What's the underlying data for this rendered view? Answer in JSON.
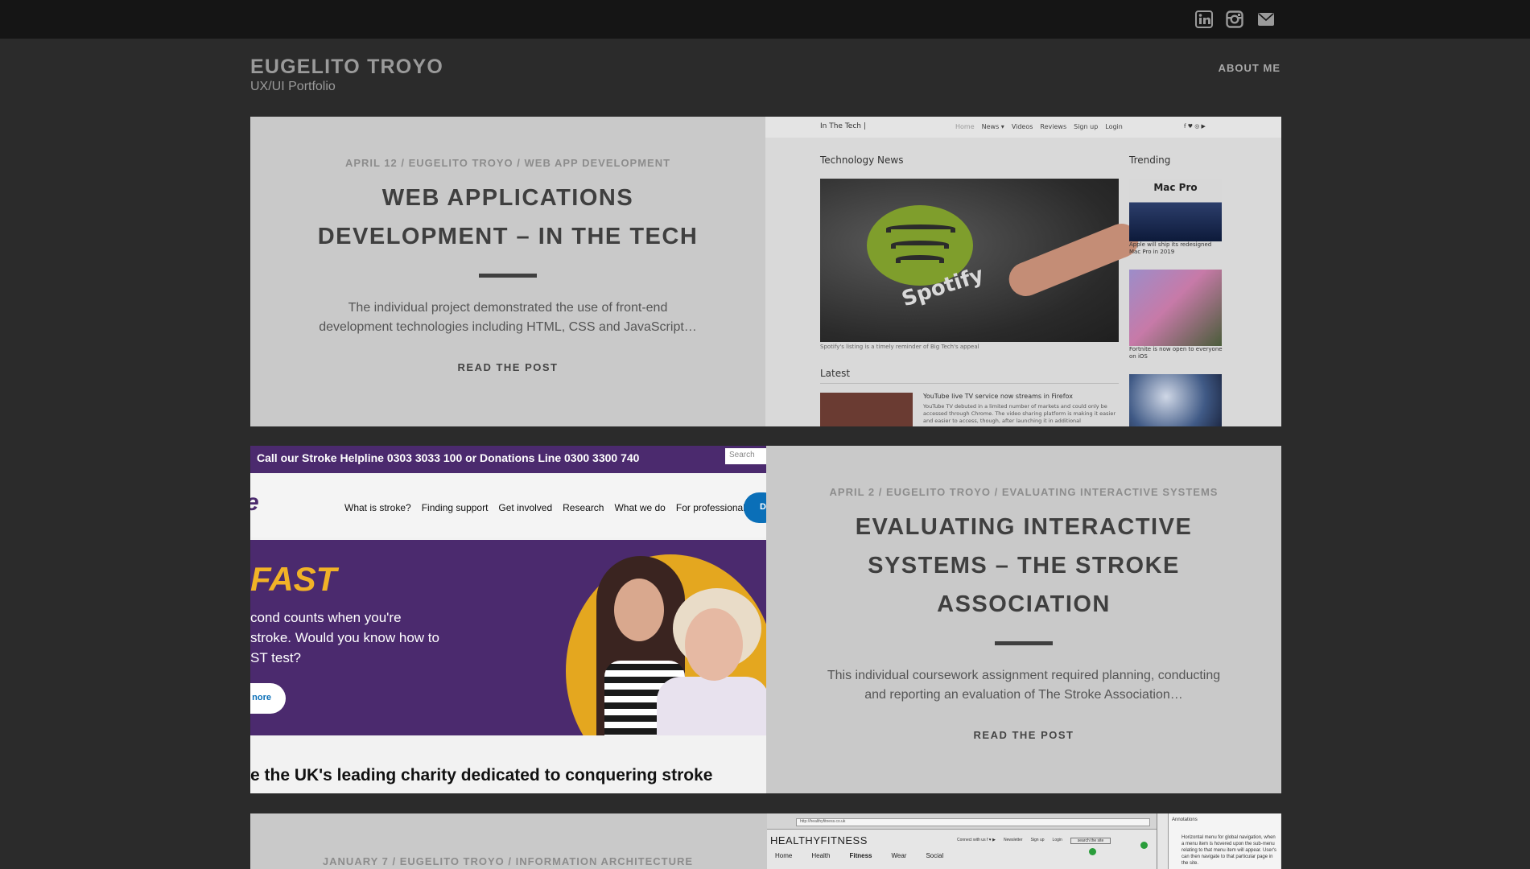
{
  "header": {
    "social_icons": [
      "linkedin-icon",
      "instagram-icon",
      "mail-icon"
    ],
    "site_title": "EUGELITO TROYO",
    "tagline": "UX/UI Portfolio",
    "about_link": "ABOUT ME"
  },
  "posts": [
    {
      "date": "APRIL 12",
      "author": "EUGELITO TROYO",
      "category": "WEB APP DEVELOPMENT",
      "title": "WEB APPLICATIONS DEVELOPMENT – IN THE TECH",
      "excerpt": "The individual project demonstrated the use of front-end development technologies including HTML, CSS and JavaScript…",
      "read_more": "READ THE POST"
    },
    {
      "date": "APRIL 2",
      "author": "EUGELITO TROYO",
      "category": "EVALUATING INTERACTIVE SYSTEMS",
      "title": "EVALUATING INTERACTIVE SYSTEMS – THE STROKE ASSOCIATION",
      "excerpt": "This individual coursework assignment required planning, conducting and reporting an evaluation of The Stroke Association…",
      "read_more": "READ THE POST"
    },
    {
      "date": "JANUARY 7",
      "author": "EUGELITO TROYO",
      "category": "INFORMATION ARCHITECTURE"
    }
  ],
  "shot_tech": {
    "logo": "In The Tech |",
    "nav": [
      "Home",
      "News ▾",
      "Videos",
      "Reviews",
      "Sign up",
      "Login"
    ],
    "social": "f  ♥  ◎  ▶",
    "section_news": "Technology News",
    "section_trending": "Trending",
    "section_latest": "Latest",
    "hero_brand": "Spotify",
    "hero_caption": "Spotify's listing is a timely reminder of Big Tech's appeal",
    "trend1_label": "Mac Pro",
    "trend1_caption": "Apple will ship its redesigned Mac Pro in 2019",
    "trend2_caption": "Fortnite is now open to everyone on iOS",
    "latest_title": "YouTube live TV service now streams in Firefox",
    "latest_text": "YouTube TV debuted in a limited number of markets and could only be accessed through Chrome. The video sharing platform is making it easier and easier to access, though, after launching it in additional"
  },
  "shot_stroke": {
    "helpline": "Call our Stroke Helpline 0303 3033 100 or Donations Line 0300 3300 740",
    "search": "Search",
    "logo_fragment": "e",
    "nav": [
      "What is stroke?",
      "Finding support",
      "Get involved",
      "Research",
      "What we do",
      "For professionals"
    ],
    "nav_button": "D",
    "fast": "FAST",
    "banner_lines": [
      "cond counts when you're",
      "stroke. Would you know how to",
      "ST test?"
    ],
    "pill": "nore",
    "tagline": "e the UK's leading charity dedicated to conquering stroke"
  },
  "shot_wire": {
    "address": "http://healthyfitness.co.uk",
    "logo": "HEALTHYFITNESS",
    "top_links": [
      "Connect with us  f  ♥  ▶",
      "Newsletter",
      "Sign up",
      "Login",
      "search the site"
    ],
    "nav": [
      "Home",
      "Health",
      "Fitness",
      "Wear",
      "Social"
    ],
    "annotations_title": "Annotations",
    "annotation_text": "Horizontal menu for global navigation, when a menu item is hovered upon the sub-menu relating to that menu item will appear. User's can then navigate to that particular page in the site."
  }
}
